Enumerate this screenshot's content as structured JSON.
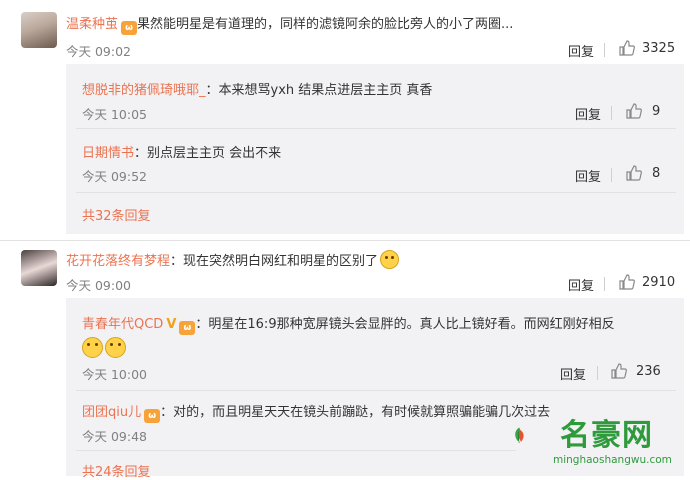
{
  "comments": [
    {
      "user": "温柔种茧",
      "has_badge": true,
      "text": "果然能明星是有道理的，同样的滤镜阿余的脸比旁人的小了两圈...",
      "time": "今天 09:02",
      "reply_label": "回复",
      "likes": "3325",
      "replies": [
        {
          "user": "想脱非的猪佩琦哦耶_",
          "text": "：本来想骂yxh 结果点进层主主页 真香",
          "time": "今天 10:05",
          "reply_label": "回复",
          "likes": "9"
        },
        {
          "user": "日期情书",
          "text": "：别点层主主页 会出不来",
          "time": "今天 09:52",
          "reply_label": "回复",
          "likes": "8"
        }
      ],
      "more_replies": "共32条回复"
    },
    {
      "user": "花开花落终有梦程",
      "text": "：现在突然明白网红和明星的区别了",
      "time": "今天 09:00",
      "reply_label": "回复",
      "likes": "2910",
      "replies": [
        {
          "user": "青春年代QCD",
          "verified_mark": "V",
          "text": "：明星在16:9那种宽屏镜头会显胖的。真人比上镜好看。而网红刚好相反",
          "time": "今天 10:00",
          "reply_label": "回复",
          "likes": "236"
        },
        {
          "user": "团团qiu儿",
          "text": "：对的，而且明星天天在镜头前蹦跶，有时候就算照骗能骗几次过去",
          "time": "今天 09:48"
        }
      ],
      "more_replies": "共24条回复"
    }
  ],
  "badge_glyph": "🐱",
  "watermark": {
    "name": "名豪网",
    "url": "minghaoshangwu.com"
  },
  "colors": {
    "link": "#eb7350",
    "time": "#808080",
    "panel": "#f2f2f5"
  }
}
